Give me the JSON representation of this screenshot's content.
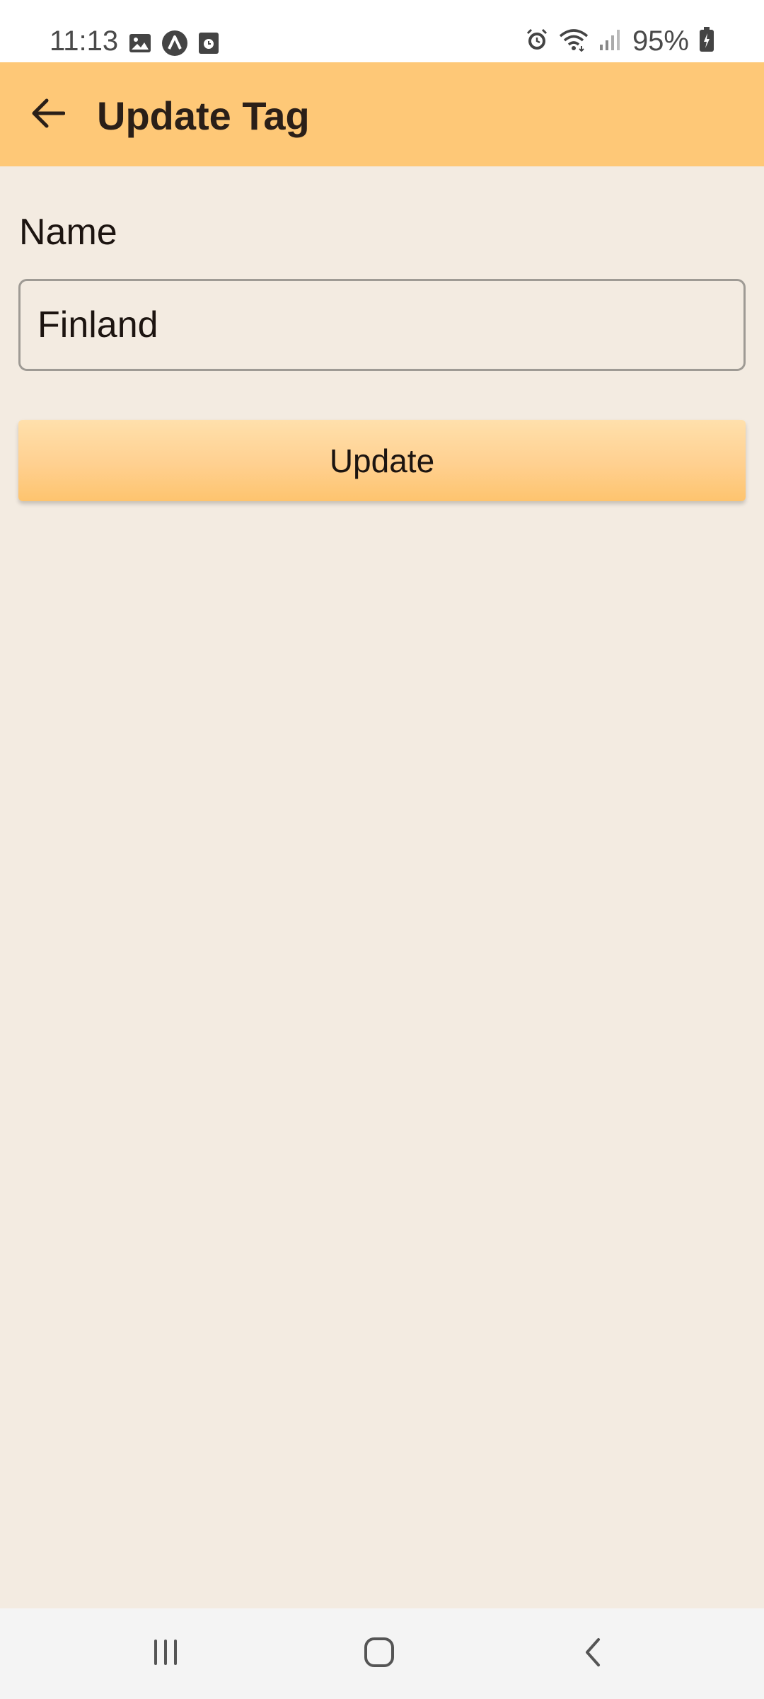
{
  "status_bar": {
    "time": "11:13",
    "battery": "95%",
    "left_icons": [
      "image-icon",
      "app-icon",
      "clock-icon"
    ],
    "right_icons": [
      "alarm-icon",
      "wifi-icon",
      "signal-icon",
      "battery-icon"
    ]
  },
  "app_bar": {
    "title": "Update Tag",
    "back_icon": "arrow-left-icon",
    "background": "#FEC877"
  },
  "form": {
    "name_label": "Name",
    "name_value": "Finland",
    "submit_label": "Update"
  },
  "nav_bar": {
    "buttons": [
      "recent-apps-icon",
      "home-icon",
      "back-icon"
    ]
  },
  "colors": {
    "background": "#F3EBE1",
    "accent": "#FEC877"
  }
}
